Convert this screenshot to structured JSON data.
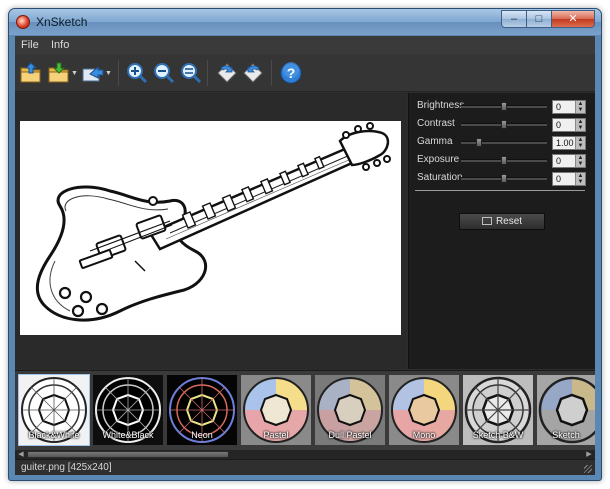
{
  "window": {
    "title": "XnSketch",
    "controls": {
      "minimize": "–",
      "maximize": "□",
      "close": "✕"
    }
  },
  "menu": [
    {
      "label": "File"
    },
    {
      "label": "Info"
    }
  ],
  "toolbar": {
    "buttons": [
      {
        "name": "open",
        "icon": "folder-open-icon"
      },
      {
        "name": "save",
        "icon": "folder-save-icon"
      },
      {
        "name": "export",
        "icon": "export-icon"
      },
      {
        "name": "zoom-in",
        "icon": "zoom-in-icon"
      },
      {
        "name": "zoom-out",
        "icon": "zoom-out-icon"
      },
      {
        "name": "zoom-fit",
        "icon": "zoom-fit-icon"
      },
      {
        "name": "rotate-left",
        "icon": "rotate-left-icon"
      },
      {
        "name": "rotate-right",
        "icon": "rotate-right-icon"
      },
      {
        "name": "help",
        "icon": "help-icon",
        "glyph": "?"
      }
    ],
    "accent": "#2f7fd6"
  },
  "adjustments": [
    {
      "label": "Brightness",
      "value": "0",
      "level": 0.5
    },
    {
      "label": "Contrast",
      "value": "0",
      "level": 0.5
    },
    {
      "label": "Gamma",
      "value": "1.00",
      "level": 0.2
    },
    {
      "label": "Exposure",
      "value": "0",
      "level": 0.5
    },
    {
      "label": "Saturation",
      "value": "0",
      "level": 0.5
    }
  ],
  "reset_label": "Reset",
  "filters": [
    {
      "label": "Black&White",
      "style": "bw",
      "selected": true
    },
    {
      "label": "White&Black",
      "style": "wb",
      "selected": false
    },
    {
      "label": "Neon",
      "style": "neon",
      "selected": false
    },
    {
      "label": "Pastel",
      "style": "pastel",
      "selected": false
    },
    {
      "label": "Dull Pastel",
      "style": "dull",
      "selected": false
    },
    {
      "label": "Mono",
      "style": "mono",
      "selected": false
    },
    {
      "label": "Sketch B&W",
      "style": "sketch",
      "selected": false
    },
    {
      "label": "Sketch",
      "style": "sketch2",
      "selected": false
    }
  ],
  "scroll": {
    "left_arrow": "◀",
    "right_arrow": "▶"
  },
  "status": {
    "text": "guiter.png [425x240]"
  }
}
